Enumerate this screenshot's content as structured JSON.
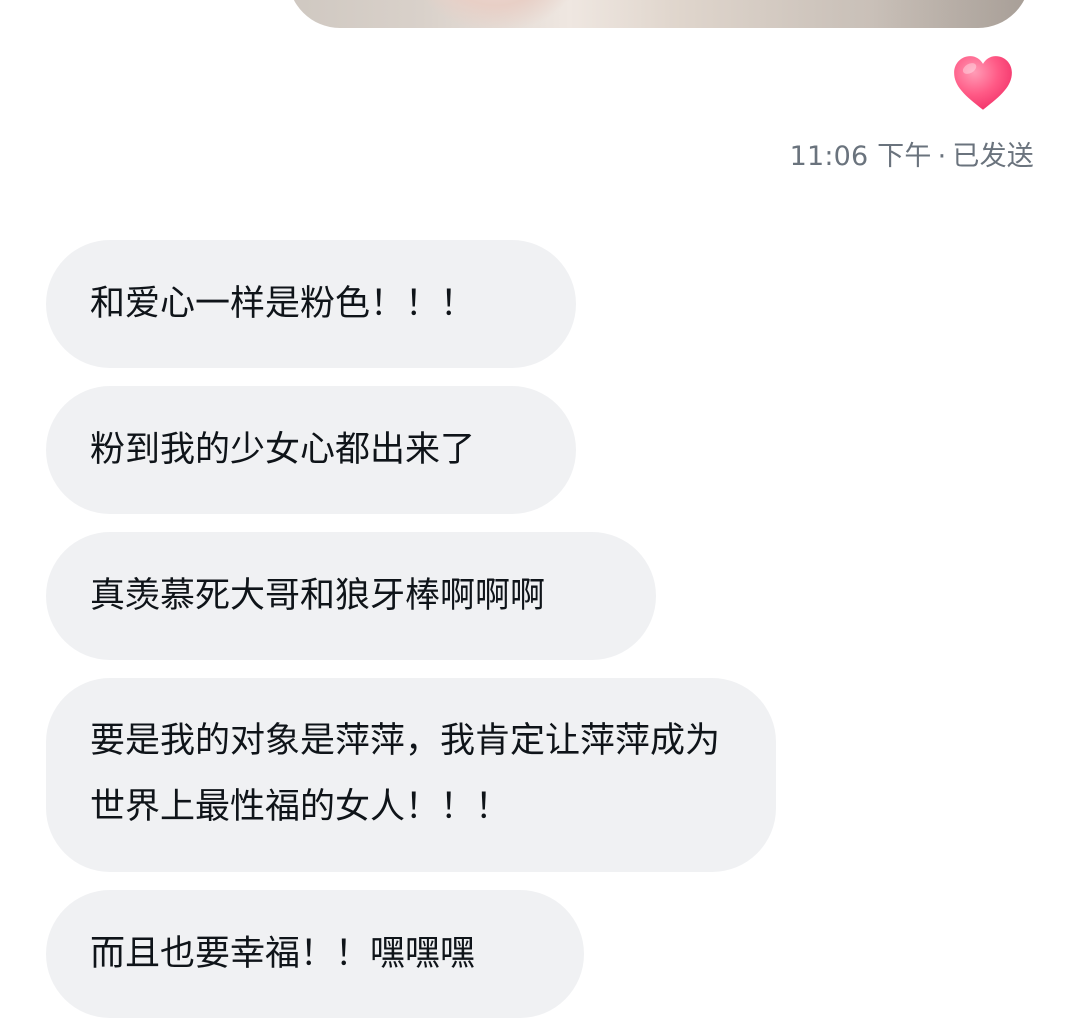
{
  "conversation": {
    "sent_message": {
      "reaction": "heart-emoji",
      "reaction_color": "#ff4d7a",
      "time": "11:06 下午",
      "separator": "·",
      "status": "已发送"
    },
    "received_messages": [
      {
        "text": "和爱心一样是粉色！！！"
      },
      {
        "text": "粉到我的少女心都出来了"
      },
      {
        "text": "真羡慕死大哥和狼牙棒啊啊啊"
      },
      {
        "text": "要是我的对象是萍萍，我肯定让萍萍成为世界上最性福的女人！！！"
      },
      {
        "text": "而且也要幸福！！嘿嘿嘿"
      }
    ],
    "bubble_color": "#f0f1f3",
    "text_color": "#0f1419",
    "meta_color": "#6a737d"
  }
}
